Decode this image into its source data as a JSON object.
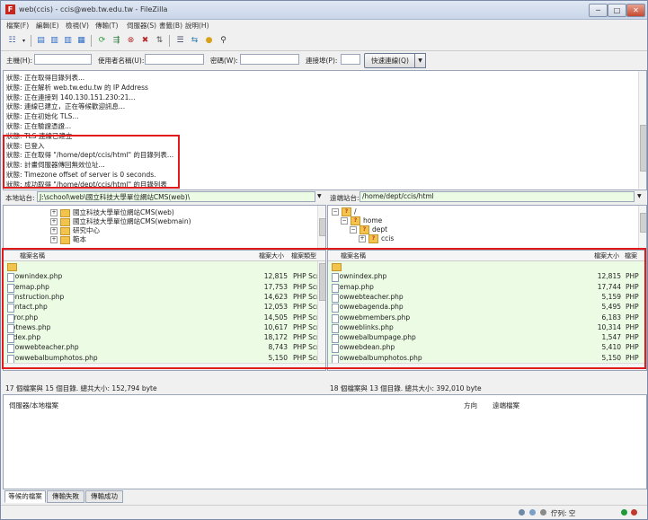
{
  "window": {
    "title": "web(ccis) - ccis@web.tw.edu.tw - FileZilla",
    "controls": [
      "─",
      "□",
      "✕"
    ]
  },
  "menu": [
    "檔案(F)",
    "編輯(E)",
    "檢視(V)",
    "傳輸(T)",
    "伺服器(S)",
    "書籤(B)",
    "說明(H)"
  ],
  "quickconnect": {
    "host_label": "主機(H):",
    "user_label": "使用者名稱(U):",
    "pass_label": "密碼(W):",
    "port_label": "連接埠(P):",
    "button": "快速連線(Q)",
    "dropdown": "▼"
  },
  "log": [
    {
      "prefix": "狀態:",
      "text": "正在取得目錄列表..."
    },
    {
      "prefix": "狀態:",
      "text": "正在解析 web.tw.edu.tw 的 IP Address"
    },
    {
      "prefix": "狀態:",
      "text": "正在連接到 140.130.151.230:21..."
    },
    {
      "prefix": "狀態:",
      "text": "連線已建立，正在等候歡迎訊息..."
    },
    {
      "prefix": "狀態:",
      "text": "正在初始化 TLS..."
    },
    {
      "prefix": "狀態:",
      "text": "正在驗證憑證..."
    },
    {
      "prefix": "狀態:",
      "text": "TLS 連線已建立"
    },
    {
      "prefix": "狀態:",
      "text": "已登入"
    },
    {
      "prefix": "狀態:",
      "text": "正在取得 \"/home/dept/ccis/html\" 的目錄列表..."
    },
    {
      "prefix": "狀態:",
      "text": "計畫伺服器傳回無效位址..."
    },
    {
      "prefix": "狀態:",
      "text": "Timezone offset of server is 0 seconds."
    },
    {
      "prefix": "狀態:",
      "text": "成功取得 \"/home/dept/ccis/html\" 的目錄列表"
    }
  ],
  "local": {
    "site_label": "本地站台:",
    "path": "J:\\school\\web\\國立科技大學單位網站CMS(web)\\",
    "tree": [
      {
        "text": "國立科技大學單位網站CMS(web)",
        "indent": 0
      },
      {
        "text": "國立科技大學單位網站CMS(webmain)",
        "indent": 0
      },
      {
        "text": "研究中心",
        "indent": 0
      },
      {
        "text": "範本",
        "indent": 0
      }
    ],
    "columns": [
      "檔案名稱",
      "檔案大小",
      "檔案類型"
    ],
    "files": [
      {
        "name": "..",
        "size": "",
        "type": ""
      },
      {
        "name": "shownindex.php",
        "size": "12,815",
        "type": "PHP Scr"
      },
      {
        "name": "sitemap.php",
        "size": "17,753",
        "type": "PHP Scr"
      },
      {
        "name": "construction.php",
        "size": "14,623",
        "type": "PHP Scr"
      },
      {
        "name": "contact.php",
        "size": "12,053",
        "type": "PHP Scr"
      },
      {
        "name": "error.php",
        "size": "14,505",
        "type": "PHP Scr"
      },
      {
        "name": "hotnews.php",
        "size": "10,617",
        "type": "PHP Scr"
      },
      {
        "name": "index.php",
        "size": "18,172",
        "type": "PHP Scr"
      },
      {
        "name": "showwebteacher.php",
        "size": "8,743",
        "type": "PHP Scr"
      },
      {
        "name": "showwebalbumphotos.php",
        "size": "5,150",
        "type": "PHP Scr"
      }
    ],
    "status": "17 個檔案與 15 個目錄. 總共大小: 152,794 byte"
  },
  "remote": {
    "site_label": "遠端站台:",
    "path": "/home/dept/ccis/html",
    "tree": [
      {
        "text": "/",
        "indent": 0
      },
      {
        "text": "home",
        "indent": 1
      },
      {
        "text": "dept",
        "indent": 2
      },
      {
        "text": "ccis",
        "indent": 3
      }
    ],
    "columns": [
      "檔案名稱",
      "檔案大小",
      "檔案"
    ],
    "files": [
      {
        "name": "..",
        "size": "",
        "type": ""
      },
      {
        "name": "shownindex.php",
        "size": "12,815",
        "type": "PHP"
      },
      {
        "name": "sitemap.php",
        "size": "17,744",
        "type": "PHP"
      },
      {
        "name": "showwebteacher.php",
        "size": "5,159",
        "type": "PHP"
      },
      {
        "name": "showwebagenda.php",
        "size": "5,495",
        "type": "PHP"
      },
      {
        "name": "showwebmembers.php",
        "size": "6,183",
        "type": "PHP"
      },
      {
        "name": "showweblinks.php",
        "size": "10,314",
        "type": "PHP"
      },
      {
        "name": "showwebalbumpage.php",
        "size": "1,547",
        "type": "PHP"
      },
      {
        "name": "showwebdean.php",
        "size": "5,410",
        "type": "PHP"
      },
      {
        "name": "showwebalbumphotos.php",
        "size": "5,150",
        "type": "PHP"
      }
    ],
    "status": "18 個檔案與 13 個目錄. 總共大小: 392,010 byte"
  },
  "queue": {
    "col_server": "伺服器/本地檔案",
    "col_direction": "方向",
    "col_remote": "遠端檔案"
  },
  "tabs": [
    "等候的檔案",
    "傳輸失敗",
    "傳輸成功"
  ],
  "statusbar": {
    "queue_text": "佇列: 空"
  }
}
